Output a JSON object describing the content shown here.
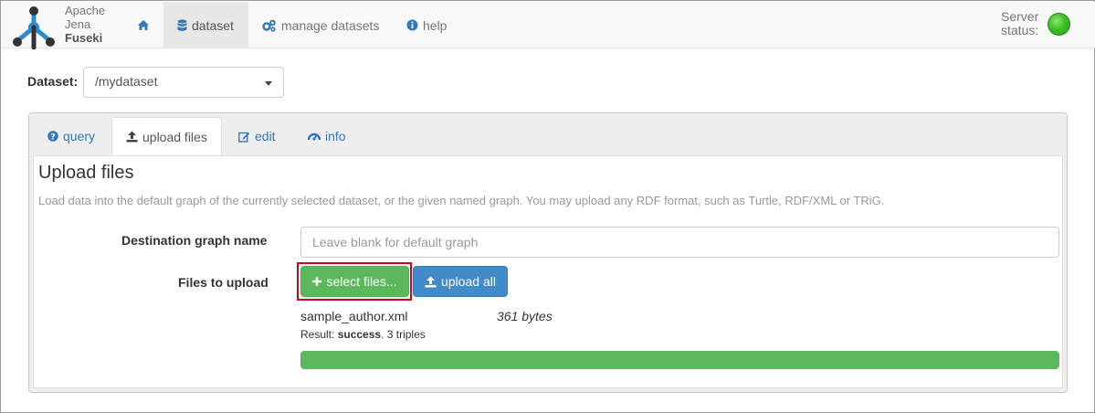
{
  "brand": {
    "line1": "Apache",
    "line2": "Jena",
    "line3": "Fuseki",
    "icon": "fuseki-logo-icon"
  },
  "nav": {
    "home_icon": "home-icon",
    "dataset": {
      "label": "dataset",
      "icon": "database-icon",
      "active": true
    },
    "manage": {
      "label": "manage datasets",
      "icon": "cogs-icon"
    },
    "help": {
      "label": "help",
      "icon": "info-circle-icon"
    }
  },
  "server_status": {
    "label_line1": "Server",
    "label_line2": "status:",
    "color": "#3fbf28"
  },
  "dataset_selector": {
    "label": "Dataset:",
    "selected": "/mydataset"
  },
  "tabs": [
    {
      "label": "query",
      "icon": "question-circle-icon",
      "active": false
    },
    {
      "label": "upload files",
      "icon": "upload-icon",
      "active": true
    },
    {
      "label": "edit",
      "icon": "edit-icon",
      "active": false
    },
    {
      "label": "info",
      "icon": "dashboard-icon",
      "active": false
    }
  ],
  "upload": {
    "title": "Upload files",
    "description": "Load data into the default graph of the currently selected dataset, or the given named graph. You may upload any RDF format, such as Turtle, RDF/XML or TRiG.",
    "dest_label": "Destination graph name",
    "dest_placeholder": "Leave blank for default graph",
    "dest_value": "",
    "files_label": "Files to upload",
    "select_button": "select files...",
    "upload_all_button": "upload all",
    "file": {
      "name": "sample_author.xml",
      "size": "361 bytes",
      "result_prefix": "Result: ",
      "result_status": "success",
      "result_suffix": ". 3 triples",
      "progress_percent": 100
    }
  },
  "colors": {
    "accent_green": "#5cb85c",
    "accent_blue": "#428bca",
    "highlight_red": "#d0021b",
    "link": "#337ab7"
  }
}
